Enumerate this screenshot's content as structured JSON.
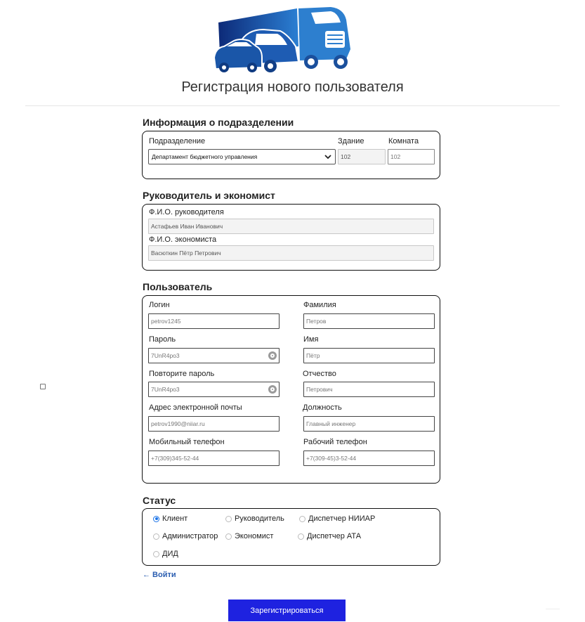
{
  "page": {
    "title": "Регистрация нового пользователя"
  },
  "logo": {
    "name": "truck-logo",
    "color": "#1a56a8"
  },
  "division": {
    "title": "Информация о подразделении",
    "unit_label": "Подразделение",
    "unit_value": "Департамент бюджетного управления",
    "building_label": "Здание",
    "building_value": "102",
    "room_label": "Комната",
    "room_placeholder": "102"
  },
  "managers": {
    "title": "Руководитель и экономист",
    "head_label": "Ф.И.О. руководителя",
    "head_value": "Астафьев Иван Иванович",
    "economist_label": "Ф.И.О. экономиста",
    "economist_value": "Васюткин Пётр Петрович"
  },
  "user": {
    "title": "Пользователь",
    "login_label": "Логин",
    "login_placeholder": "petrov1245",
    "lastname_label": "Фамилия",
    "lastname_placeholder": "Петров",
    "password_label": "Пароль",
    "password_value": "7UnR4po3",
    "firstname_label": "Имя",
    "firstname_placeholder": "Пётр",
    "password2_label": "Повторите пароль",
    "password2_value": "7UnR4po3",
    "patronymic_label": "Отчество",
    "patronymic_placeholder": "Петрович",
    "email_label": "Адрес электронной почты",
    "email_placeholder": "petrov1990@niiar.ru",
    "position_label": "Должность",
    "position_placeholder": "Главный инженер",
    "mobile_label": "Мобильный телефон",
    "mobile_placeholder": "+7(309)345-52-44",
    "work_phone_label": "Рабочий телефон",
    "work_phone_placeholder": "+7(309-45)3-52-44"
  },
  "status": {
    "title": "Статус",
    "options": [
      {
        "label": "Клиент",
        "selected": true
      },
      {
        "label": "Руководитель",
        "selected": false
      },
      {
        "label": "Диспетчер НИИАР",
        "selected": false
      },
      {
        "label": "Администратор",
        "selected": false
      },
      {
        "label": "Экономист",
        "selected": false
      },
      {
        "label": "Диспетчер АТА",
        "selected": false
      },
      {
        "label": "ДИД",
        "selected": false
      }
    ]
  },
  "links": {
    "login": "← Войти"
  },
  "actions": {
    "register": "Зарегистрироваться"
  },
  "colors": {
    "accent": "#1e22e0",
    "link": "#2a5db0",
    "radio": "#1a73e8"
  }
}
